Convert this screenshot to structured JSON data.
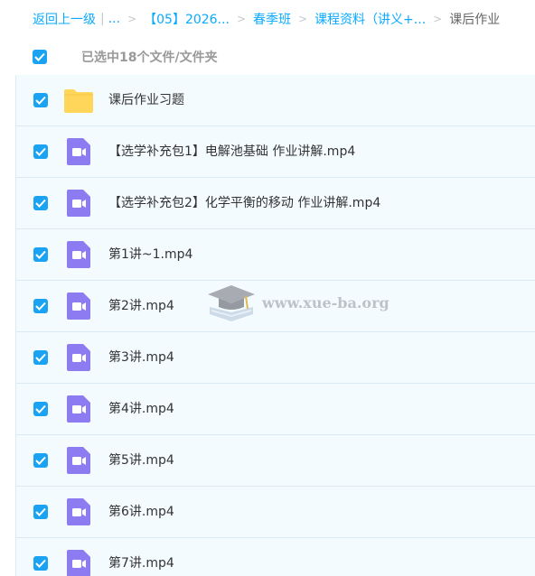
{
  "breadcrumb": {
    "back_label": "返回上一级",
    "ellipsis": "...",
    "crumbs": [
      "【05】2026...",
      "春季班",
      "课程资料（讲义+..."
    ],
    "current": "课后作业"
  },
  "selection": {
    "text": "已选中18个文件/文件夹",
    "checked": true
  },
  "files": [
    {
      "name": "课后作业习题",
      "type": "folder",
      "icon": "folder-icon"
    },
    {
      "name": "【选学补充包1】电解池基础 作业讲解.mp4",
      "type": "video",
      "icon": "video-file-icon"
    },
    {
      "name": "【选学补充包2】化学平衡的移动 作业讲解.mp4",
      "type": "video",
      "icon": "video-file-icon"
    },
    {
      "name": "第1讲~1.mp4",
      "type": "video",
      "icon": "video-file-icon"
    },
    {
      "name": "第2讲.mp4",
      "type": "video",
      "icon": "video-file-icon"
    },
    {
      "name": "第3讲.mp4",
      "type": "video",
      "icon": "video-file-icon"
    },
    {
      "name": "第4讲.mp4",
      "type": "video",
      "icon": "video-file-icon"
    },
    {
      "name": "第5讲.mp4",
      "type": "video",
      "icon": "video-file-icon"
    },
    {
      "name": "第6讲.mp4",
      "type": "video",
      "icon": "video-file-icon"
    },
    {
      "name": "第7讲.mp4",
      "type": "video",
      "icon": "video-file-icon"
    }
  ],
  "watermark": {
    "text": "www.xue-ba.org",
    "icon": "graduation-cap-icon"
  },
  "colors": {
    "accent": "#09aaff",
    "checkbox": "#1aa3f3",
    "row_bg": "#f4fbff",
    "folder": "#ffd659",
    "video": "#8d7cf1"
  }
}
